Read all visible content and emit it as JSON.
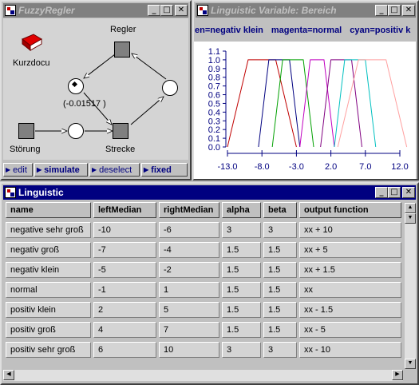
{
  "fuzzy_window": {
    "title": "FuzzyRegler",
    "buttons": {
      "minimize": "_",
      "maximize": "□",
      "close": "✕"
    },
    "nodes": {
      "kurzdocu": "Kurzdocu",
      "regler": "Regler",
      "value": "(-0.01517 )",
      "stoerung": "Störung",
      "strecke": "Strecke"
    },
    "toolbar": {
      "edit": "edit",
      "simulate": "simulate",
      "deselect": "deselect",
      "fixed": "fixed"
    }
  },
  "linguistic_variable_window": {
    "title": "Linguistic Variable:  Bereich",
    "legend": {
      "green": "en=negativ klein",
      "magenta": "magenta=normal",
      "cyan": "cyan=positiv k"
    },
    "buttons": {
      "minimize": "_",
      "maximize": "□",
      "close": "✕"
    }
  },
  "chart_data": {
    "type": "line",
    "y_ticks": [
      "1.1",
      "1.0",
      "0.9",
      "0.8",
      "0.7",
      "0.6",
      "0.5",
      "0.4",
      "0.3",
      "0.2",
      "0.1",
      "0.0"
    ],
    "x_ticks": [
      "-13.0",
      "-8.0",
      "-3.0",
      "2.0",
      "7.0",
      "12.0"
    ],
    "xlim": [
      -13,
      12
    ],
    "ylim": [
      0,
      1.1
    ],
    "series": [
      {
        "color": "#c00000",
        "points": [
          [
            -13,
            0
          ],
          [
            -10,
            1
          ],
          [
            -6,
            1
          ],
          [
            -3,
            0
          ]
        ]
      },
      {
        "color": "#000080",
        "points": [
          [
            -8.5,
            0
          ],
          [
            -7,
            1
          ],
          [
            -4,
            1
          ],
          [
            -2.5,
            0
          ]
        ]
      },
      {
        "color": "#00a000",
        "points": [
          [
            -6.5,
            0
          ],
          [
            -5,
            1
          ],
          [
            -2,
            1
          ],
          [
            -0.5,
            0
          ]
        ]
      },
      {
        "color": "#c000c0",
        "points": [
          [
            -2.5,
            0
          ],
          [
            -1,
            1
          ],
          [
            1,
            1
          ],
          [
            2.5,
            0
          ]
        ]
      },
      {
        "color": "#800080",
        "points": [
          [
            0.5,
            0
          ],
          [
            2,
            1
          ],
          [
            5,
            1
          ],
          [
            6.5,
            0
          ]
        ]
      },
      {
        "color": "#00c0c0",
        "points": [
          [
            2.5,
            0
          ],
          [
            4,
            1
          ],
          [
            7,
            1
          ],
          [
            8.5,
            0
          ]
        ]
      },
      {
        "color": "#ffa0a0",
        "points": [
          [
            3,
            0
          ],
          [
            6,
            1
          ],
          [
            10,
            1
          ],
          [
            13,
            0
          ]
        ]
      }
    ]
  },
  "linguistic_window": {
    "title": "Linguistic",
    "buttons": {
      "minimize": "_",
      "maximize": "□",
      "close": "✕"
    },
    "columns": [
      "name",
      "leftMedian",
      "rightMedian",
      "alpha",
      "beta",
      "output function"
    ],
    "rows": [
      [
        "negative sehr groß",
        "-10",
        "-6",
        "3",
        "3",
        "xx + 10"
      ],
      [
        "negativ groß",
        "-7",
        "-4",
        "1.5",
        "1.5",
        "xx + 5"
      ],
      [
        "negativ klein",
        "-5",
        "-2",
        "1.5",
        "1.5",
        "xx + 1.5"
      ],
      [
        "normal",
        "-1",
        "1",
        "1.5",
        "1.5",
        "xx"
      ],
      [
        "positiv klein",
        "2",
        "5",
        "1.5",
        "1.5",
        "xx - 1.5"
      ],
      [
        "positiv groß",
        "4",
        "7",
        "1.5",
        "1.5",
        "xx - 5"
      ],
      [
        "positiv sehr groß",
        "6",
        "10",
        "3",
        "3",
        "xx - 10"
      ]
    ]
  }
}
